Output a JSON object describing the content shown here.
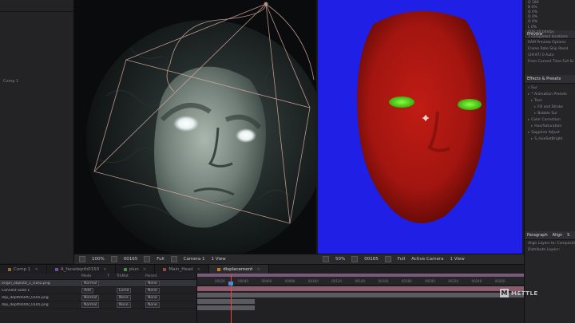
{
  "colors": {
    "accent_blue": "#4a8ad6",
    "playhead": "#e04848",
    "matte_blue": "#1f1fe6",
    "face_red": "#b01818",
    "eye_green": "#55e010",
    "work_area": "#7a5a7a",
    "layer_bar": "#5a5a5f"
  },
  "left_panel": {
    "rows": [
      "Comp 1"
    ]
  },
  "viewer_left": {
    "zoom": "100%",
    "timecode": "00165",
    "resolution": "Full",
    "camera": "Camera 1",
    "views": "1 View"
  },
  "viewer_right": {
    "zoom": "50%",
    "timecode": "00165",
    "resolution": "Full",
    "camera": "Active Camera",
    "views": "1 View"
  },
  "timeline_tabs": [
    {
      "label": "Comp 1",
      "color": "#8a6a3a"
    },
    {
      "label": "A_facedepth0150",
      "color": "#7a4aa0"
    },
    {
      "label": "plun",
      "color": "#4a8a4a"
    },
    {
      "label": "Main_Head",
      "color": "#8a4a4a"
    },
    {
      "label": "displacement",
      "color": "#c87a2a",
      "active": true
    }
  ],
  "timeline": {
    "columns": [
      "Mode",
      "T",
      "TrkMat",
      "Parent"
    ],
    "layers": [
      {
        "name": "origin_object0_1_0165.png",
        "mode": "Normal",
        "trkmat": "",
        "parent": "None",
        "selected": true
      },
      {
        "name": "Connect Solid 1",
        "mode": "Add",
        "trkmat": "Luma",
        "parent": "None"
      },
      {
        "name": "dsp_depth0000_0165.png",
        "mode": "Normal",
        "trkmat": "None",
        "parent": "None"
      },
      {
        "name": "dsp_depth0000_0165.png",
        "mode": "Normal",
        "trkmat": "None",
        "parent": "None"
      }
    ],
    "ruler_ticks": [
      "00020",
      "00040",
      "00060",
      "00080",
      "00100",
      "00120",
      "00140",
      "00160",
      "00180",
      "00200",
      "00220",
      "00240",
      "00260"
    ]
  },
  "right_panel": {
    "top_lines": [
      "Q 180",
      "B 0%",
      "Q 0%",
      "Q 0%",
      "Q 0%",
      "L 0%"
    ],
    "info_lines": [
      "EDS:10 bitsfps",
      "1 completed locations"
    ],
    "preview": {
      "title": "Preview",
      "lines": [
        "RAM Preview Options",
        "Frame Rate  Skip  Resol",
        "(29.97)  0  Auto",
        "From Current Time  Full Sc"
      ]
    },
    "effects": {
      "title": "Effects & Presets",
      "search": "Sur",
      "tree": [
        {
          "text": "* Animation Presets",
          "level": 0
        },
        {
          "text": "Text",
          "level": 1
        },
        {
          "text": "Fill and Stroke",
          "level": 2
        },
        {
          "text": "Bubble Sur",
          "level": 2
        },
        {
          "text": "Color Correction",
          "level": 0
        },
        {
          "text": "Hue/Saturation",
          "level": 1
        },
        {
          "text": "Sapphire Adjust",
          "level": 0
        },
        {
          "text": "S_HueSatBright",
          "level": 1
        }
      ]
    },
    "bottom": {
      "tabs": [
        "Paragraph",
        "Align",
        "S"
      ],
      "lines": [
        "Align Layers to:  Composition",
        "Distribute Layers:"
      ]
    }
  },
  "brand": {
    "name": "METTLE"
  }
}
